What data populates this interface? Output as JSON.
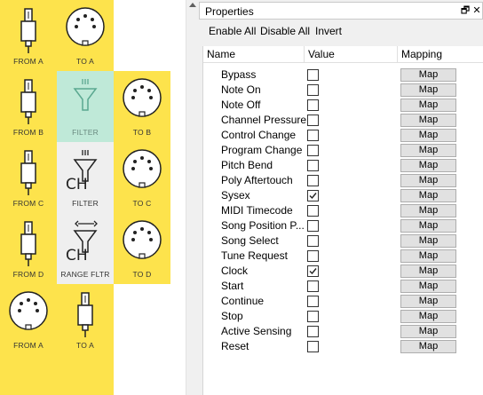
{
  "canvas": {
    "nodes": [
      {
        "id": "n1",
        "label": "FROM A",
        "icon": "midi-plug-icon"
      },
      {
        "id": "n2",
        "label": "TO A",
        "icon": "midi-din-socket-icon"
      },
      {
        "id": "n3",
        "label": "FROM B",
        "icon": "midi-plug-icon"
      },
      {
        "id": "n4",
        "label": "FILTER",
        "icon": "filter-funnel-icon"
      },
      {
        "id": "n5",
        "label": "TO B",
        "icon": "midi-din-socket-icon"
      },
      {
        "id": "n6",
        "label": "FROM C",
        "icon": "midi-plug-icon"
      },
      {
        "id": "n7",
        "label": "FILTER",
        "icon": "channel-filter-icon",
        "badge": "CH"
      },
      {
        "id": "n8",
        "label": "TO C",
        "icon": "midi-din-socket-icon"
      },
      {
        "id": "n9",
        "label": "FROM D",
        "icon": "midi-plug-icon"
      },
      {
        "id": "n10",
        "label": "RANGE FLTR",
        "icon": "range-filter-icon",
        "badge": "CH"
      },
      {
        "id": "n11",
        "label": "TO D",
        "icon": "midi-din-socket-icon"
      },
      {
        "id": "n12",
        "label": "FROM A",
        "icon": "midi-din-socket-icon"
      },
      {
        "id": "n13",
        "label": "TO A",
        "icon": "midi-plug-icon"
      }
    ]
  },
  "panel": {
    "title": "Properties",
    "float_glyph": "🗗",
    "close_glyph": "✕",
    "toolbar": {
      "enable_all": "Enable All",
      "disable_all": "Disable All",
      "invert": "Invert"
    },
    "headers": {
      "name": "Name",
      "value": "Value",
      "mapping": "Mapping"
    },
    "map_label": "Map",
    "rows": [
      {
        "name": "Bypass",
        "checked": false
      },
      {
        "name": "Note On",
        "checked": false
      },
      {
        "name": "Note Off",
        "checked": false
      },
      {
        "name": "Channel Pressure",
        "checked": false
      },
      {
        "name": "Control Change",
        "checked": false
      },
      {
        "name": "Program Change",
        "checked": false
      },
      {
        "name": "Pitch Bend",
        "checked": false
      },
      {
        "name": "Poly Aftertouch",
        "checked": false
      },
      {
        "name": "Sysex",
        "checked": true
      },
      {
        "name": "MIDI Timecode",
        "checked": false
      },
      {
        "name": "Song Position P...",
        "checked": false
      },
      {
        "name": "Song Select",
        "checked": false
      },
      {
        "name": "Tune Request",
        "checked": false
      },
      {
        "name": "Clock",
        "checked": true
      },
      {
        "name": "Start",
        "checked": false
      },
      {
        "name": "Continue",
        "checked": false
      },
      {
        "name": "Stop",
        "checked": false
      },
      {
        "name": "Active Sensing",
        "checked": false
      },
      {
        "name": "Reset",
        "checked": false
      }
    ]
  },
  "colors": {
    "node_yellow": "#fde34c",
    "filter_selected": "#bfe9d8",
    "filter_gray": "#efefef"
  }
}
